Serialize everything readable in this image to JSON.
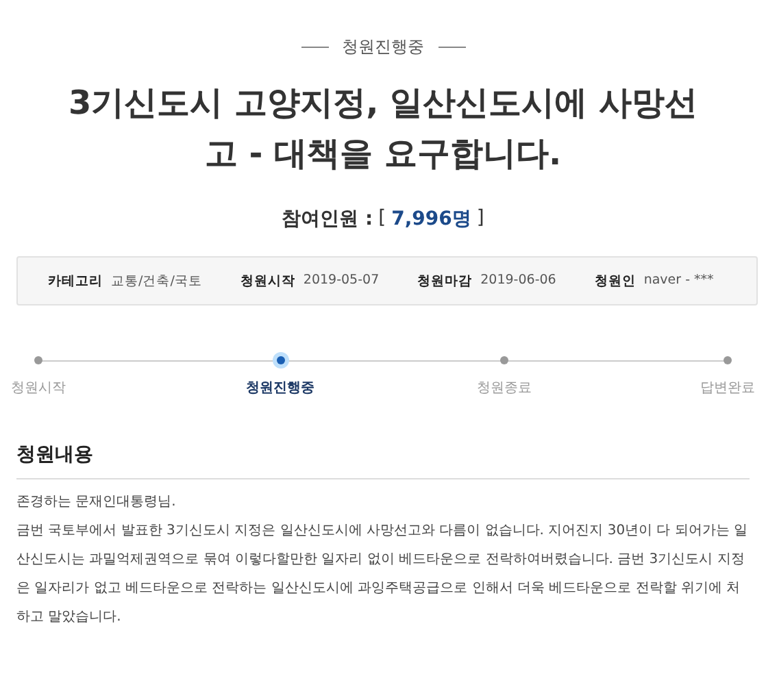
{
  "status_label": "청원진행중",
  "title": "3기신도시 고양지정, 일산신도시에 사망선고 - 대책을 요구합니다.",
  "participants": {
    "label": "참여인원 :",
    "open": "[",
    "count": "7,996명",
    "close": "]"
  },
  "info": [
    {
      "label": "카테고리",
      "value": "교통/건축/국토"
    },
    {
      "label": "청원시작",
      "value": "2019-05-07"
    },
    {
      "label": "청원마감",
      "value": "2019-06-06"
    },
    {
      "label": "청원인",
      "value": "naver - ***"
    }
  ],
  "steps": [
    {
      "label": "청원시작",
      "selected": false
    },
    {
      "label": "청원진행중",
      "selected": true
    },
    {
      "label": "청원종료",
      "selected": false
    },
    {
      "label": "답변완료",
      "selected": false
    }
  ],
  "content": {
    "heading": "청원내용",
    "paragraphs": [
      "존경하는 문재인대통령님.",
      "금번 국토부에서 발표한 3기신도시 지정은 일산신도시에 사망선고와 다름이 없습니다. 지어진지 30년이 다 되어가는 일산신도시는 과밀억제권역으로 묶여 이렇다할만한 일자리 없이 베드타운으로 전락하여버렸습니다. 금번 3기신도시 지정은 일자리가 없고 베드타운으로 전락하는 일산신도시에 과잉주택공급으로 인해서 더욱 베드타운으로 전락할 위기에 처하고 말았습니다."
    ]
  }
}
